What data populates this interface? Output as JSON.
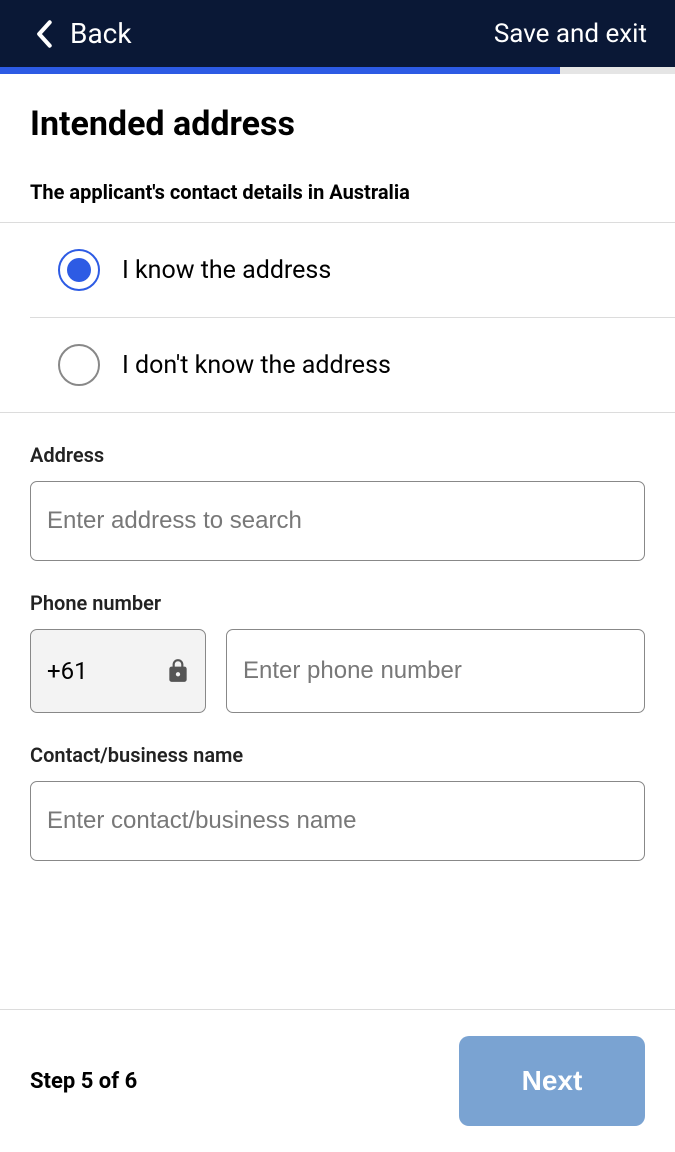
{
  "header": {
    "back_label": "Back",
    "save_exit_label": "Save and exit"
  },
  "progress": {
    "percent": 83
  },
  "page": {
    "title": "Intended address",
    "subtitle": "The applicant's contact details in Australia"
  },
  "radios": {
    "option1": "I know the address",
    "option2": "I don't know the address",
    "selected": 0
  },
  "fields": {
    "address": {
      "label": "Address",
      "placeholder": "Enter address to search"
    },
    "phone": {
      "label": "Phone number",
      "country_code": "+61",
      "placeholder": "Enter phone number"
    },
    "contact": {
      "label": "Contact/business name",
      "placeholder": "Enter contact/business name"
    }
  },
  "footer": {
    "step_text": "Step 5 of 6",
    "next_label": "Next"
  }
}
